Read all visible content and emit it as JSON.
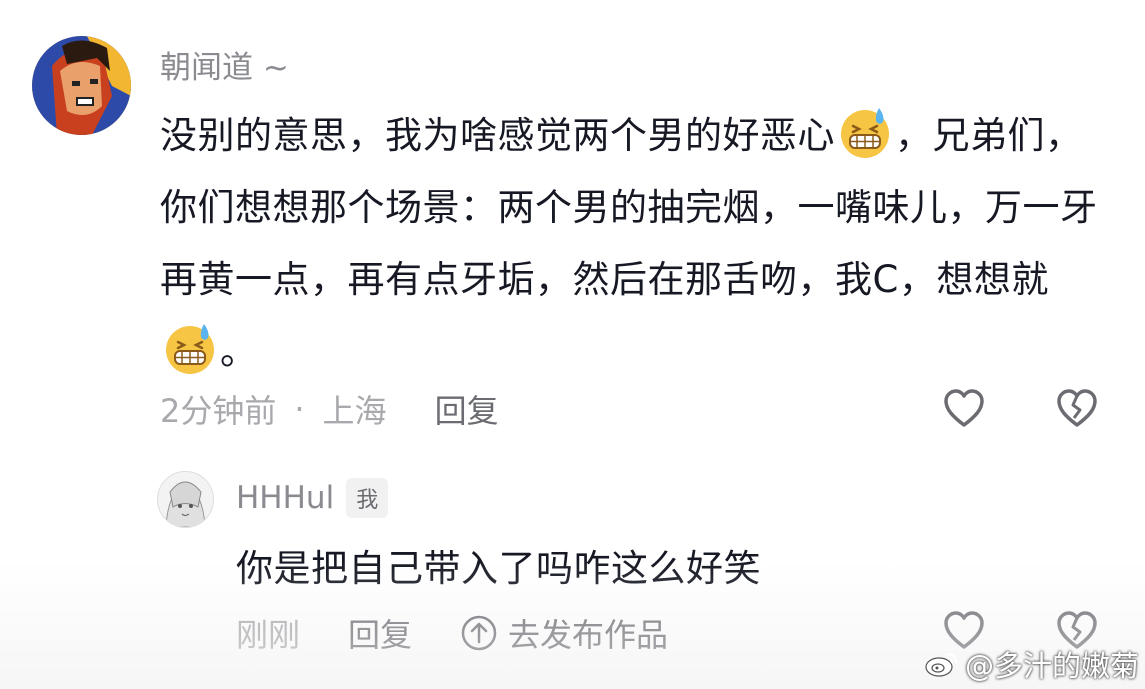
{
  "comment": {
    "username": "朝闻道 ~",
    "parts": [
      "没别的意思，我为啥感觉两个男的好恶心",
      "，兄弟们，你们想想那个场景：两个男的抽完烟，一嘴味儿，万一牙再黄一点，再有点牙垢，然后在那舌吻，我C，想想就",
      "。"
    ],
    "emoji": "grimacing-sweat-emoji",
    "time": "2分钟前",
    "separator": "·",
    "location": "上海",
    "reply_label": "回复"
  },
  "reply": {
    "username": "HHHul",
    "badge": "我",
    "text": "你是把自己带入了吗咋这么好笑",
    "time": "刚刚",
    "reply_label": "回复",
    "goto_works_label": "去发布作品"
  },
  "watermark": {
    "text": "@多汁的嫩菊"
  },
  "colors": {
    "text": "#161823",
    "secondary": "#8a8b91",
    "meta": "#a8a9ad"
  }
}
